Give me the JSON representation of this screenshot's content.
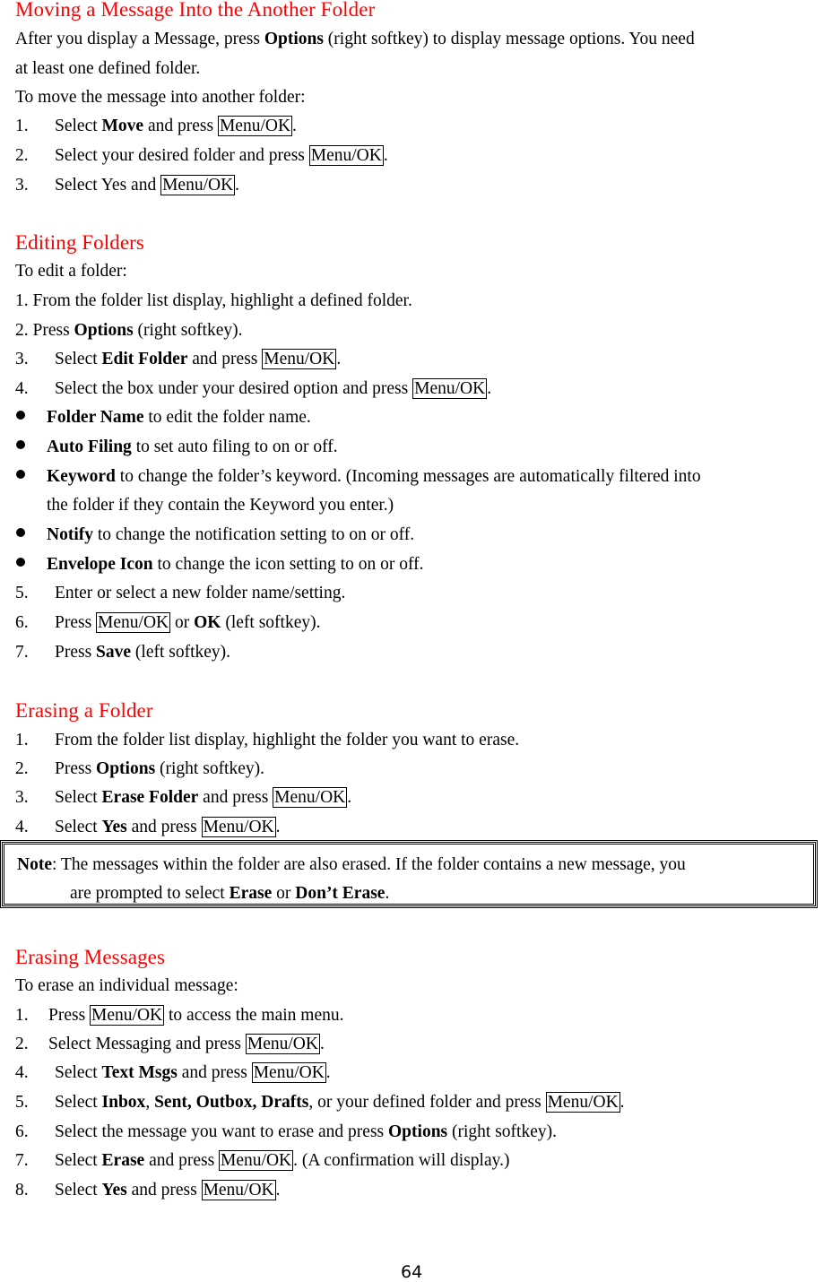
{
  "sections": {
    "moving": {
      "heading": "Moving a Message Into the Another Folder",
      "p1a": "After you display a Message, press ",
      "p1b": "Options",
      "p1c": " (right softkey) to display message options. You need",
      "p2": "at least one defined folder.",
      "p3": "To move the message into another folder:",
      "steps": [
        {
          "num": "1.",
          "pre": "Select ",
          "bold": "Move",
          "mid": " and press ",
          "key": "Menu/OK",
          "post": "."
        },
        {
          "num": "2.",
          "pre": "Select your desired folder and press ",
          "key": "Menu/OK",
          "post": "."
        },
        {
          "num": "3.",
          "pre": "Select Yes and ",
          "key": "Menu/OK",
          "post": "."
        }
      ]
    },
    "editing": {
      "heading": "Editing Folders",
      "intro": "To edit a folder:",
      "s1": "1. From the folder list display, highlight a defined folder.",
      "s2a": "2. Press ",
      "s2b": "Options",
      "s2c": " (right softkey).",
      "steps": [
        {
          "num": "3.",
          "pre": "Select ",
          "bold": "Edit Folder",
          "mid": " and press ",
          "key": "Menu/OK",
          "post": "."
        },
        {
          "num": "4.",
          "pre": "Select the box under your desired option and press ",
          "key": "Menu/OK",
          "post": "."
        }
      ],
      "bullets": [
        {
          "bold": "Folder Name",
          "text": " to edit the folder name."
        },
        {
          "bold": "Auto Filing",
          "text": " to set auto filing to on or off."
        },
        {
          "bold": "Keyword",
          "text": " to change the folder’s keyword. (Incoming messages are automatically filtered into",
          "cont": "the folder if they contain the Keyword you enter.)"
        },
        {
          "bold": "Notify",
          "text": " to change the notification setting to on or off."
        },
        {
          "bold": "Envelope Icon",
          "text": " to change the icon setting to on or off."
        }
      ],
      "steps2": [
        {
          "num": "5.",
          "text": "Enter or select a new folder name/setting."
        },
        {
          "num": "6.",
          "pre": "Press ",
          "key": "Menu/OK",
          "mid": " or ",
          "bold": "OK",
          "post": " (left softkey)."
        },
        {
          "num": "7.",
          "pre": "Press ",
          "bold": "Save",
          "post": " (left softkey)."
        }
      ]
    },
    "erasing_folder": {
      "heading": "Erasing a Folder",
      "steps": [
        {
          "num": "1.",
          "text": "From the folder list display, highlight the folder you want to erase."
        },
        {
          "num": "2.",
          "pre": "Press ",
          "bold": "Options",
          "post": " (right softkey)."
        },
        {
          "num": "3.",
          "pre": "Select ",
          "bold": "Erase Folder",
          "mid": " and press ",
          "key": "Menu/OK",
          "post": "."
        },
        {
          "num": "4.",
          "pre": "Select ",
          "bold": "Yes",
          "mid": " and press ",
          "key": "Menu/OK",
          "post": "."
        }
      ],
      "note": {
        "label": "Note",
        "t1": ": The messages within the folder are also erased. If the folder contains a new message, you",
        "t2a": "are prompted to select ",
        "t2b": "Erase",
        "t2c": " or ",
        "t2d": "Don’t Erase",
        "t2e": "."
      }
    },
    "erasing_messages": {
      "heading": "Erasing Messages",
      "intro": "To erase an individual message:",
      "steps": [
        {
          "num": "1.",
          "pre": "Press ",
          "key": "Menu/OK",
          "post": " to access the main menu."
        },
        {
          "num": "2.",
          "pre": "Select Messaging and press ",
          "key": "Menu/OK",
          "post": "."
        },
        {
          "num": "4.",
          "pre": "Select ",
          "bold": "Text Msgs",
          "mid": " and press ",
          "key": "Menu/OK",
          "post": "."
        },
        {
          "num": "5.",
          "pre": "Select ",
          "bold": "Inbox",
          "mid": ", ",
          "bold2": "Sent, Outbox, Drafts",
          "mid2": ", or your defined folder and press ",
          "key": "Menu/OK",
          "post": "."
        },
        {
          "num": "6.",
          "pre": "Select the message you want to erase and press ",
          "bold": "Options",
          "post": " (right softkey)."
        },
        {
          "num": "7.",
          "pre": "Select ",
          "bold": "Erase",
          "mid": " and press ",
          "key": "Menu/OK",
          "post": ". (A confirmation will display.)"
        },
        {
          "num": "8.",
          "pre": "Select ",
          "bold": "Yes",
          "mid": " and press ",
          "key": "Menu/OK",
          "post": "."
        }
      ]
    }
  },
  "page_number": "64"
}
